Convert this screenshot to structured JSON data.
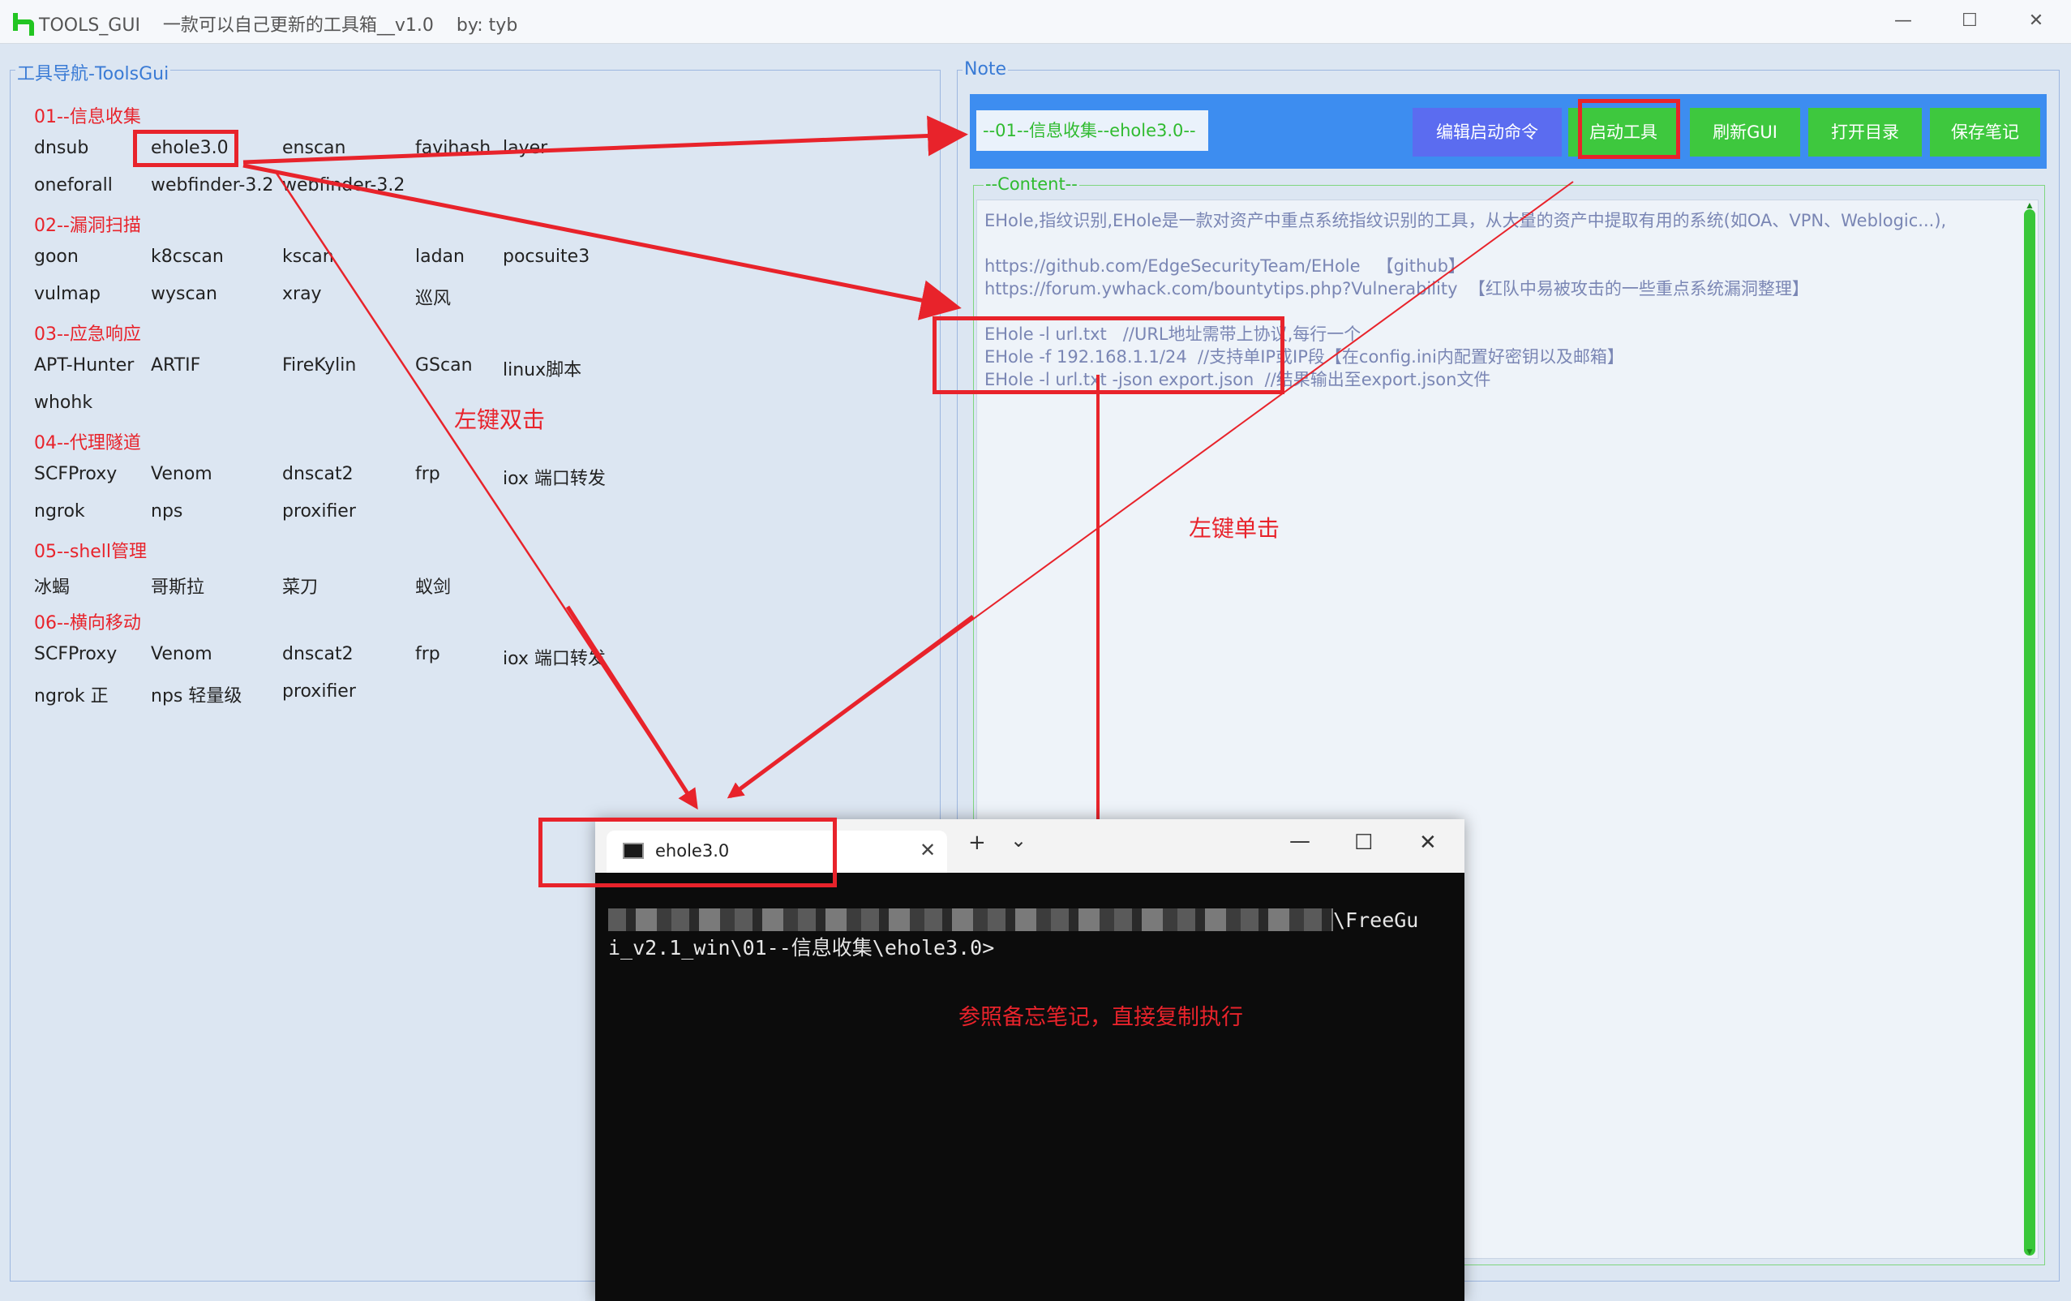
{
  "window": {
    "title": "TOOLS_GUI    一款可以自己更新的工具箱__v1.0    by: tyb",
    "minimize_glyph": "—",
    "maximize_glyph": "☐",
    "close_glyph": "✕"
  },
  "left_panel": {
    "title": "工具导航-ToolsGui",
    "categories": [
      {
        "label": "01--信息收集",
        "tools": [
          "dnsub",
          "ehole3.0",
          "enscan",
          "favihash",
          "layer",
          "oneforall",
          "webfinder-3.2",
          "webfinder-3.2"
        ]
      },
      {
        "label": "02--漏洞扫描",
        "tools": [
          "goon",
          "k8cscan",
          "kscan",
          "ladan",
          "pocsuite3",
          "vulmap",
          "wyscan",
          "xray",
          "巡风"
        ]
      },
      {
        "label": "03--应急响应",
        "tools": [
          "APT-Hunter",
          "ARTIF",
          "FireKylin",
          "GScan",
          "linux脚本",
          "whohk"
        ]
      },
      {
        "label": "04--代理隧道",
        "tools": [
          "SCFProxy",
          "Venom",
          "dnscat2",
          "frp",
          "iox 端口转发",
          "ngrok",
          "nps",
          "proxifier"
        ]
      },
      {
        "label": "05--shell管理",
        "tools": [
          "冰蝎",
          "哥斯拉",
          "菜刀",
          "蚁剑"
        ]
      },
      {
        "label": "06--横向移动",
        "tools": [
          "SCFProxy",
          "Venom",
          "dnscat2",
          "frp",
          "iox 端口转发",
          "ngrok 正",
          "nps 轻量级",
          "proxifier"
        ]
      }
    ]
  },
  "note_panel": {
    "title": "Note",
    "current_tool": "--01--信息收集--ehole3.0--",
    "buttons": [
      "编辑启动命令",
      "启动工具",
      "刷新GUI",
      "打开目录",
      "保存笔记"
    ],
    "colors": {
      "toolbar": "#3d8df0",
      "edit_button": "#5b6cf0",
      "action_button": "#3ec83e"
    },
    "content_label": "--Content--",
    "content_lines": [
      "EHole,指纹识别,EHole是一款对资产中重点系统指纹识别的工具，从大量的资产中提取有用的系统(如OA、VPN、Weblogic...),",
      "",
      "https://github.com/EdgeSecurityTeam/EHole   【github】",
      "https://forum.ywhack.com/bountytips.php?Vulnerability  【红队中易被攻击的一些重点系统漏洞整理】",
      "",
      "EHole -l url.txt   //URL地址需带上协议,每行一个",
      "EHole -f 192.168.1.1/24  //支持单IP或IP段【在config.ini内配置好密钥以及邮箱】",
      "EHole -l url.txt -json export.json  //结果输出至export.json文件"
    ]
  },
  "annotations": {
    "double_click": "左键双击",
    "single_click": "左键单击",
    "copy_hint": "参照备忘笔记，直接复制执行",
    "color": "#e8232b"
  },
  "terminal": {
    "tab_title": "ehole3.0",
    "tab_close": "✕",
    "new_tab": "+",
    "dropdown": "⌄",
    "minimize": "—",
    "maximize": "☐",
    "close": "✕",
    "line1_visible": "\\FreeGu",
    "line2": "i_v2.1_win\\01--信息收集\\ehole3.0>"
  }
}
